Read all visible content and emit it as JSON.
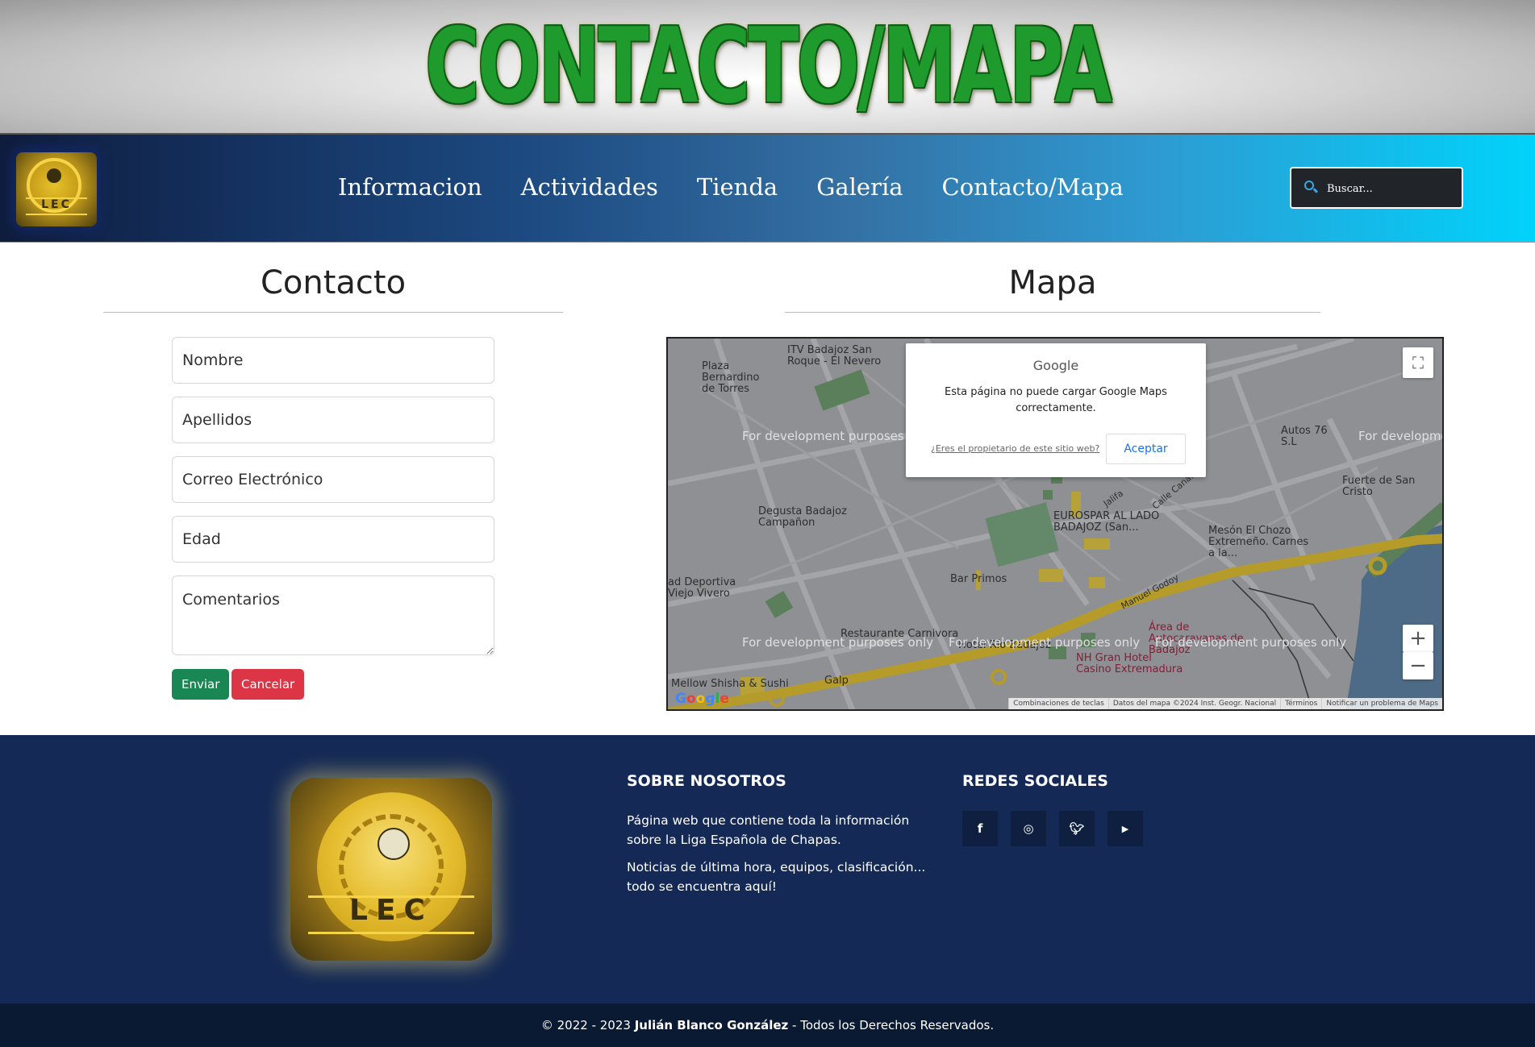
{
  "banner": {
    "title": "CONTACTO/MAPA"
  },
  "nav": {
    "logo_text": "LEC",
    "links": [
      "Informacion",
      "Actividades",
      "Tienda",
      "Galería",
      "Contacto/Mapa"
    ],
    "search_placeholder": "Buscar..."
  },
  "contact": {
    "title": "Contacto",
    "fields": {
      "name": "Nombre",
      "surname": "Apellidos",
      "email": "Correo Electrónico",
      "age": "Edad",
      "comments": "Comentarios"
    },
    "send_label": "Enviar",
    "cancel_label": "Cancelar"
  },
  "map": {
    "title": "Mapa",
    "dialog": {
      "brand": "Google",
      "message": "Esta página no puede cargar Google Maps correctamente.",
      "owner_link": "¿Eres el propietario de este sitio web?",
      "accept": "Aceptar"
    },
    "dev_text": "For development purposes only",
    "labels": {
      "plaza": "Plaza Bernardino de Torres",
      "itv": "ITV Badajoz San Roque - El Nevero",
      "degusta": "Degusta Badajoz Campañon",
      "eurospar": "EUROSPAR AL LADO BADAJOZ (San...",
      "meson": "Mesón El Chozo Extremeño. Carnes a la...",
      "fuerte": "Fuerte de San Cristo",
      "autos": "Autos 76 S.L",
      "bar": "Bar Primos",
      "deportiva": "ad Deportiva Viejo Vivero",
      "restaurante": "Restaurante Carnivora",
      "hotel": "Hotel Río Badajoz",
      "nh": "NH Gran Hotel Casino Extremadura",
      "area": "Área de Autocaravanas de Badajoz",
      "mellow": "Mellow Shisha & Sushi",
      "galp": "Galp",
      "manuel": "Manuel Godoy",
      "jalifa": "Jalifa",
      "calle": "Calle Canaria"
    },
    "footer": [
      "Combinaciones de teclas",
      "Datos del mapa ©2024 Inst. Geogr. Nacional",
      "Términos",
      "Notificar un problema de Maps"
    ],
    "google_logo": "Google"
  },
  "footer": {
    "logo_text": "LEC",
    "about_title": "SOBRE NOSOTROS",
    "about_p1": "Página web que contiene toda la información sobre la Liga Española de Chapas.",
    "about_p2": "Noticias de última hora, equipos, clasificación... todo se encuentra aquí!",
    "social_title": "REDES SOCIALES",
    "social_icons": [
      "facebook-icon",
      "instagram-icon",
      "twitter-icon",
      "youtube-icon"
    ],
    "copyright_prefix": "© 2022 - 2023 ",
    "copyright_name": "Julián Blanco González",
    "copyright_suffix": " - Todos los Derechos Reservados."
  }
}
